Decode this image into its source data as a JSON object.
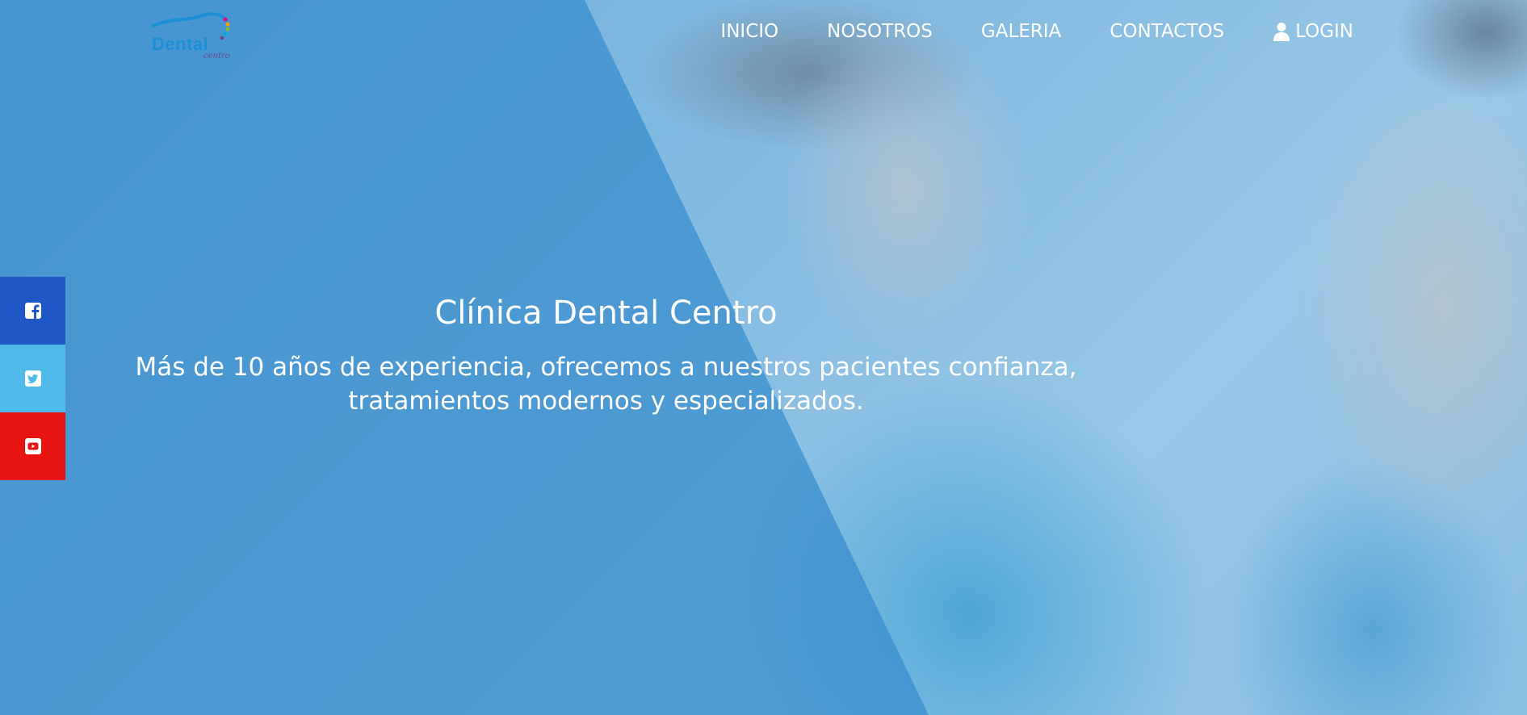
{
  "brand": {
    "logo_text": "Dental",
    "logo_sub": "centro",
    "colors": {
      "logo_blue": "#1a8fd6",
      "logo_purple": "#6a4a8c"
    }
  },
  "nav": {
    "items": [
      {
        "label": "INICIO"
      },
      {
        "label": "NOSOTROS"
      },
      {
        "label": "GALERIA"
      },
      {
        "label": "CONTACTOS"
      }
    ],
    "login_label": "LOGIN",
    "login_icon": "user-icon"
  },
  "hero": {
    "title": "Clínica Dental Centro",
    "subtitle": "Más de 10 años de experiencia, ofrecemos a nuestros pacientes confianza, tratamientos modernos y especializados.",
    "overlay_color": "#378ccd"
  },
  "social": {
    "items": [
      {
        "icon": "facebook-icon",
        "color": "#2156c6"
      },
      {
        "icon": "twitter-icon",
        "color": "#4fb9e9"
      },
      {
        "icon": "youtube-icon",
        "color": "#e81414"
      }
    ]
  }
}
